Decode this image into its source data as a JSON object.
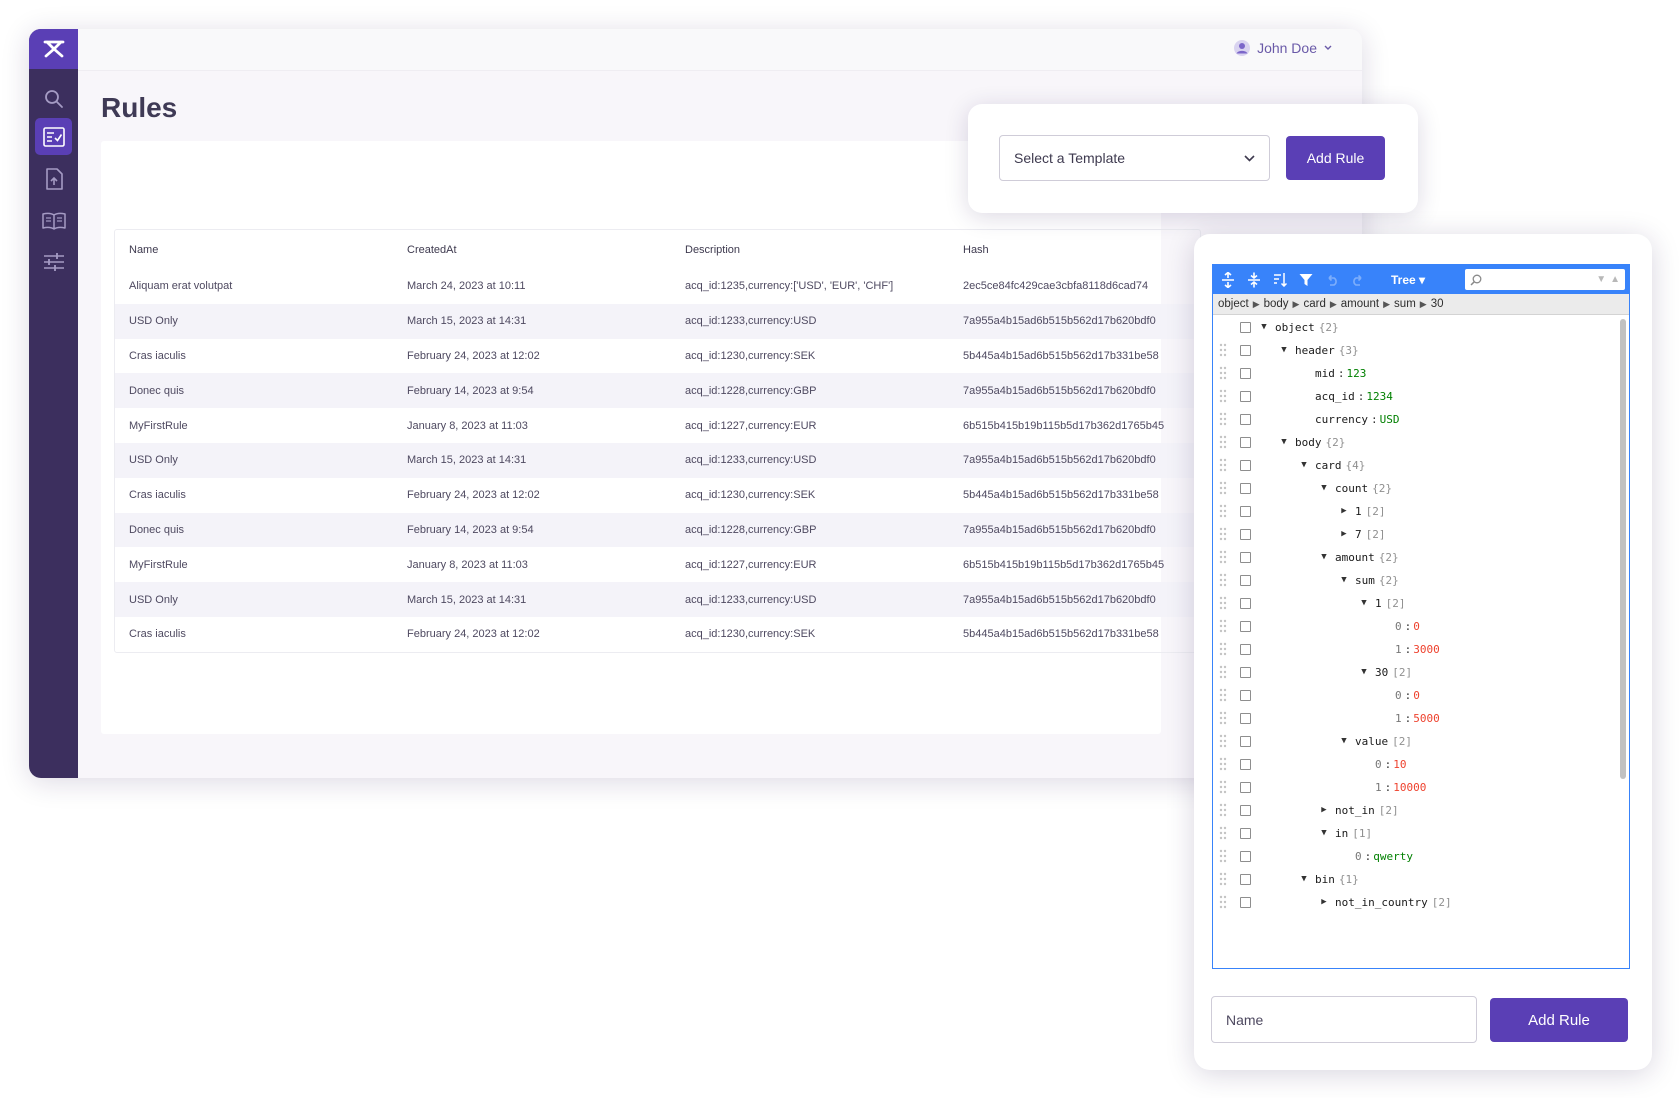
{
  "header": {
    "user_name": "John Doe"
  },
  "page": {
    "title": "Rules"
  },
  "sidebar": {
    "items": [
      {
        "id": "search",
        "icon": "search-icon",
        "active": false
      },
      {
        "id": "rules",
        "icon": "checklist-icon",
        "active": true
      },
      {
        "id": "upload",
        "icon": "file-upload-icon",
        "active": false
      },
      {
        "id": "docs",
        "icon": "book-icon",
        "active": false
      },
      {
        "id": "settings",
        "icon": "sliders-icon",
        "active": false
      }
    ]
  },
  "template_panel": {
    "select_placeholder": "Select a Template",
    "add_label": "Add Rule"
  },
  "table": {
    "columns": [
      "Name",
      "CreatedAt",
      "Description",
      "Hash"
    ],
    "rows": [
      [
        "Aliquam erat volutpat",
        "March 24, 2023 at 10:11",
        "acq_id:1235,currency:['USD', 'EUR', 'CHF']",
        "2ec5ce84fc429cae3cbfa8118d6cad74"
      ],
      [
        "USD Only",
        "March 15, 2023 at 14:31",
        "acq_id:1233,currency:USD",
        "7a955a4b15ad6b515b562d17b620bdf0"
      ],
      [
        "Cras iaculis",
        "February 24, 2023 at 12:02",
        "acq_id:1230,currency:SEK",
        "5b445a4b15ad6b515b562d17b331be58"
      ],
      [
        "Donec quis",
        "February 14, 2023 at 9:54",
        "acq_id:1228,currency:GBP",
        "7a955a4b15ad6b515b562d17b620bdf0"
      ],
      [
        "MyFirstRule",
        "January 8, 2023 at 11:03",
        "acq_id:1227,currency:EUR",
        "6b515b415b19b115b5d17b362d1765b45"
      ],
      [
        "USD Only",
        "March 15, 2023 at 14:31",
        "acq_id:1233,currency:USD",
        "7a955a4b15ad6b515b562d17b620bdf0"
      ],
      [
        "Cras iaculis",
        "February 24, 2023 at 12:02",
        "acq_id:1230,currency:SEK",
        "5b445a4b15ad6b515b562d17b331be58"
      ],
      [
        "Donec quis",
        "February 14, 2023 at 9:54",
        "acq_id:1228,currency:GBP",
        "7a955a4b15ad6b515b562d17b620bdf0"
      ],
      [
        "MyFirstRule",
        "January 8, 2023 at 11:03",
        "acq_id:1227,currency:EUR",
        "6b515b415b19b115b5d17b362d1765b45"
      ],
      [
        "USD Only",
        "March 15, 2023 at 14:31",
        "acq_id:1233,currency:USD",
        "7a955a4b15ad6b515b562d17b620bdf0"
      ],
      [
        "Cras iaculis",
        "February 24, 2023 at 12:02",
        "acq_id:1230,currency:SEK",
        "5b445a4b15ad6b515b562d17b331be58"
      ]
    ]
  },
  "editor": {
    "mode_label": "Tree",
    "breadcrumb": [
      "object",
      "body",
      "card",
      "amount",
      "sum",
      "30"
    ],
    "tree": [
      {
        "level": 0,
        "key": "object",
        "count": "{2}",
        "exp": "open"
      },
      {
        "level": 1,
        "key": "header",
        "count": "{3}",
        "exp": "open"
      },
      {
        "level": 2,
        "key": "mid",
        "value": "123",
        "vtype": "str"
      },
      {
        "level": 2,
        "key": "acq_id",
        "value": "1234",
        "vtype": "str"
      },
      {
        "level": 2,
        "key": "currency",
        "value": "USD",
        "vtype": "str"
      },
      {
        "level": 1,
        "key": "body",
        "count": "{2}",
        "exp": "open"
      },
      {
        "level": 2,
        "key": "card",
        "count": "{4}",
        "exp": "open"
      },
      {
        "level": 3,
        "key": "count",
        "count": "{2}",
        "exp": "open"
      },
      {
        "level": 4,
        "key": "1",
        "count": "[2]",
        "exp": "closed",
        "idx": true
      },
      {
        "level": 4,
        "key": "7",
        "count": "[2]",
        "exp": "closed",
        "idx": true
      },
      {
        "level": 3,
        "key": "amount",
        "count": "{2}",
        "exp": "open"
      },
      {
        "level": 4,
        "key": "sum",
        "count": "{2}",
        "exp": "open"
      },
      {
        "level": 5,
        "key": "1",
        "count": "[2]",
        "exp": "open"
      },
      {
        "level": 6,
        "key": "0",
        "value": "0",
        "vtype": "num",
        "idx": true
      },
      {
        "level": 6,
        "key": "1",
        "value": "3000",
        "vtype": "num",
        "idx": true
      },
      {
        "level": 5,
        "key": "30",
        "count": "[2]",
        "exp": "open"
      },
      {
        "level": 6,
        "key": "0",
        "value": "0",
        "vtype": "num",
        "idx": true
      },
      {
        "level": 6,
        "key": "1",
        "value": "5000",
        "vtype": "num",
        "idx": true
      },
      {
        "level": 4,
        "key": "value",
        "count": "[2]",
        "exp": "open"
      },
      {
        "level": 5,
        "key": "0",
        "value": "10",
        "vtype": "num",
        "idx": true
      },
      {
        "level": 5,
        "key": "1",
        "value": "10000",
        "vtype": "num",
        "idx": true
      },
      {
        "level": 3,
        "key": "not_in",
        "count": "[2]",
        "exp": "closed"
      },
      {
        "level": 3,
        "key": "in",
        "count": "[1]",
        "exp": "open"
      },
      {
        "level": 4,
        "key": "0",
        "value": "qwerty",
        "vtype": "str",
        "idx": true
      },
      {
        "level": 2,
        "key": "bin",
        "count": "{1}",
        "exp": "open"
      },
      {
        "level": 3,
        "key": "not_in_country",
        "count": "[2]",
        "exp": "closed"
      }
    ],
    "name_placeholder": "Name",
    "add_label": "Add Rule"
  },
  "colors": {
    "brand": "#5a3fb5",
    "sidebar": "#3c2f5e",
    "editor_accent": "#3883fa",
    "number": "#ee422e",
    "string": "#008000"
  }
}
